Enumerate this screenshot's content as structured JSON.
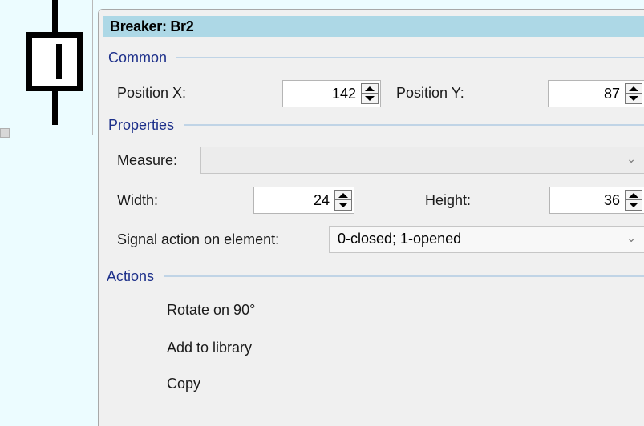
{
  "panel": {
    "title": "Breaker: Br2"
  },
  "sections": {
    "common": "Common",
    "properties": "Properties",
    "actions": "Actions"
  },
  "common": {
    "position_x_label": "Position X:",
    "position_x_value": "142",
    "position_y_label": "Position Y:",
    "position_y_value": "87"
  },
  "properties": {
    "measure_label": "Measure:",
    "measure_value": "",
    "width_label": "Width:",
    "width_value": "24",
    "height_label": "Height:",
    "height_value": "36",
    "signal_label": "Signal action on element:",
    "signal_value": "0-closed; 1-opened"
  },
  "actions": {
    "items": [
      "Rotate on 90°",
      "Add to library",
      "Copy"
    ]
  },
  "colors": {
    "canvas_bg": "#ecfcff",
    "header_bg": "#add8e6",
    "section_text": "#1c2f8a",
    "panel_bg": "#f0f0f0"
  },
  "icons": {
    "breaker_symbol": "breaker-symbol-icon",
    "spin_up": "spin-up-icon",
    "spin_down": "spin-down-icon",
    "dropdown": "chevron-down-icon"
  }
}
